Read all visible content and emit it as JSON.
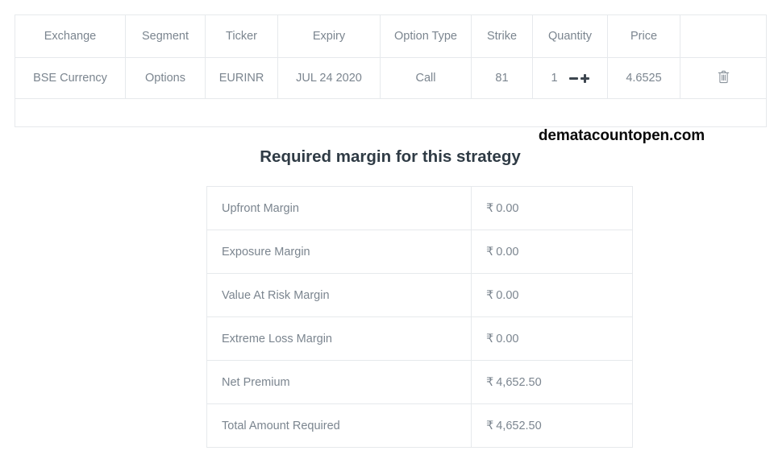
{
  "legs_table": {
    "columns": [
      {
        "key": "exchange",
        "label": "Exchange"
      },
      {
        "key": "segment",
        "label": "Segment"
      },
      {
        "key": "ticker",
        "label": "Ticker"
      },
      {
        "key": "expiry",
        "label": "Expiry"
      },
      {
        "key": "option_type",
        "label": "Option Type"
      },
      {
        "key": "strike",
        "label": "Strike"
      },
      {
        "key": "quantity",
        "label": "Quantity"
      },
      {
        "key": "price",
        "label": "Price"
      },
      {
        "key": "actions",
        "label": ""
      }
    ],
    "rows": [
      {
        "exchange": "BSE Currency",
        "segment": "Options",
        "ticker": "EURINR",
        "expiry": "JUL 24 2020",
        "option_type": "Call",
        "strike": "81",
        "quantity": "1",
        "price": "4.6525",
        "decrease_icon": "minus-icon",
        "increase_icon": "plus-icon",
        "delete_icon": "trash-icon"
      }
    ]
  },
  "watermark": {
    "text": "dematacountopen.com"
  },
  "margin_section": {
    "heading": "Required margin for this strategy",
    "currency_symbol": "₹",
    "rows": [
      {
        "label": "Upfront Margin",
        "value": "0.00"
      },
      {
        "label": "Exposure Margin",
        "value": "0.00"
      },
      {
        "label": "Value At Risk Margin",
        "value": "0.00"
      },
      {
        "label": "Extreme Loss Margin",
        "value": "0.00"
      },
      {
        "label": "Net Premium",
        "value": "4,652.50"
      },
      {
        "label": "Total Amount Required",
        "value": "4,652.50"
      }
    ]
  },
  "colors": {
    "text_muted": "#7b858f",
    "heading": "#2f3b45",
    "border": "#e6e9ec",
    "watermark": "#0a0a0a",
    "stepper": "#3d464f"
  }
}
